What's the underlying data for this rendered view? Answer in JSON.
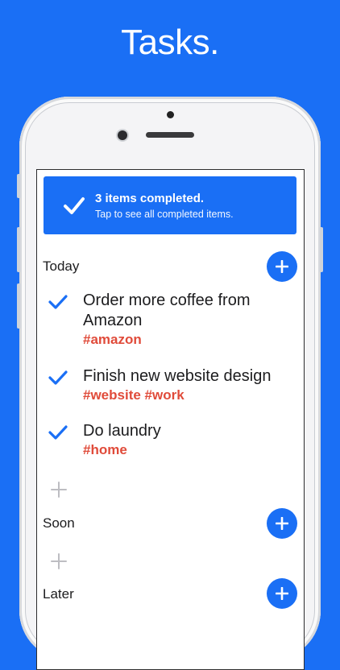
{
  "headline": "Tasks.",
  "colors": {
    "accent": "#1a6ff5",
    "tag": "#e04b3a"
  },
  "banner": {
    "title": "3 items completed.",
    "subtitle": "Tap to see all completed items.",
    "icon": "checkmark-icon"
  },
  "sections": [
    {
      "label": "Today",
      "tasks": [
        {
          "line1": "Order more coffee from",
          "line2": "Amazon",
          "tags": "#amazon",
          "completed": true
        },
        {
          "line1": "Finish new website design",
          "tags": "#website #work",
          "completed": true
        },
        {
          "line1": "Do laundry",
          "tags": "#home",
          "completed": true
        }
      ]
    },
    {
      "label": "Soon",
      "tasks": []
    },
    {
      "label": "Later",
      "tasks": []
    }
  ]
}
